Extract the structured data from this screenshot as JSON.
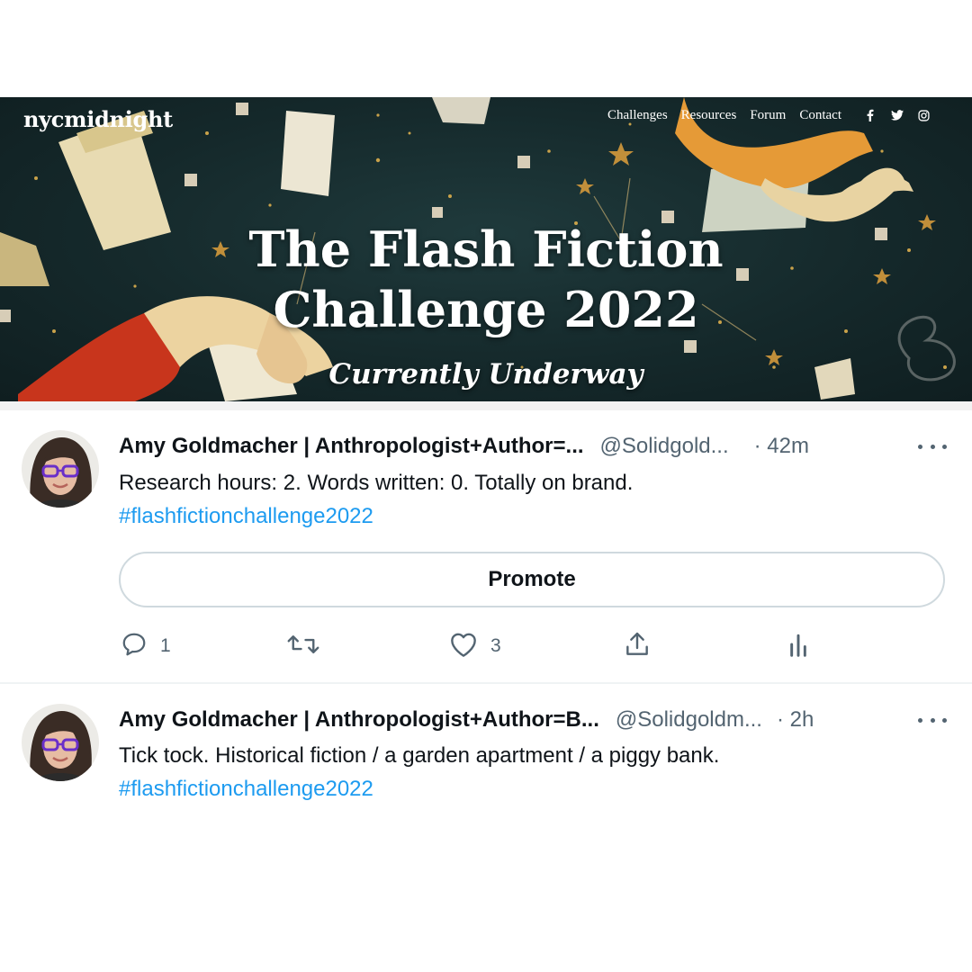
{
  "banner": {
    "logo": "nycmidnight",
    "nav": [
      "Challenges",
      "Resources",
      "Forum",
      "Contact"
    ],
    "social_icons": [
      "facebook-icon",
      "twitter-icon",
      "instagram-icon"
    ],
    "title_line1": "The Flash Fiction",
    "title_line2": "Challenge 2022",
    "subtitle": "Currently Underway"
  },
  "tweets": [
    {
      "name": "Amy Goldmacher | Anthropologist+Author=...",
      "handle": "@Solidgold...",
      "time": "· 42m",
      "text": "Research hours: 2. Words written: 0. Totally on brand.",
      "hashtag": "#flashfictionchallenge2022",
      "promote_label": "Promote",
      "reply_count": "1",
      "like_count": "3"
    },
    {
      "name": "Amy Goldmacher | Anthropologist+Author=B...",
      "handle": "@Solidgoldm...",
      "time": "· 2h",
      "text": "Tick tock. Historical fiction / a garden apartment / a piggy bank.",
      "hashtag": "#flashfictionchallenge2022"
    }
  ],
  "colors": {
    "link": "#1d9bf0",
    "text": "#0f1419",
    "secondary": "#536471",
    "banner_bg": "#15292b"
  }
}
